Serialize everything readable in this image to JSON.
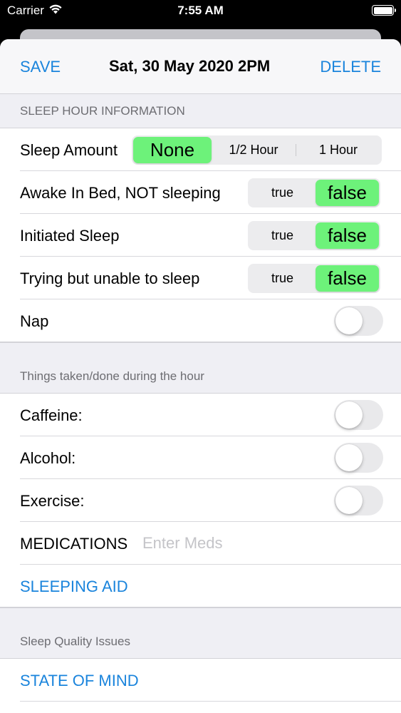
{
  "status_bar": {
    "carrier": "Carrier",
    "time": "7:55 AM"
  },
  "nav": {
    "save_label": "SAVE",
    "title": "Sat, 30 May 2020   2PM",
    "delete_label": "DELETE"
  },
  "sections": {
    "sleep_hour": {
      "header": "SLEEP HOUR INFORMATION",
      "sleep_amount": {
        "label": "Sleep Amount",
        "options": [
          "None",
          "1/2 Hour",
          "1 Hour"
        ],
        "selected": "None"
      },
      "awake_in_bed": {
        "label": "Awake In Bed, NOT sleeping",
        "options": [
          "true",
          "false"
        ],
        "selected": "false"
      },
      "initiated_sleep": {
        "label": "Initiated Sleep",
        "options": [
          "true",
          "false"
        ],
        "selected": "false"
      },
      "trying_unable": {
        "label": "Trying but unable to sleep",
        "options": [
          "true",
          "false"
        ],
        "selected": "false"
      },
      "nap": {
        "label": "Nap",
        "on": false
      }
    },
    "things_taken": {
      "header": "Things taken/done during the hour",
      "caffeine": {
        "label": "Caffeine:",
        "on": false
      },
      "alcohol": {
        "label": "Alcohol:",
        "on": false
      },
      "exercise": {
        "label": "Exercise:",
        "on": false
      },
      "medications": {
        "label": "MEDICATIONS",
        "value": "",
        "placeholder": "Enter Meds"
      },
      "sleeping_aid": {
        "label": "SLEEPING AID"
      }
    },
    "sleep_quality": {
      "header": "Sleep Quality Issues",
      "state_of_mind": {
        "label": "STATE OF MIND"
      }
    }
  },
  "colors": {
    "accent": "#1a84dc",
    "selected_segment": "#6df27a",
    "background": "#efeff4"
  }
}
